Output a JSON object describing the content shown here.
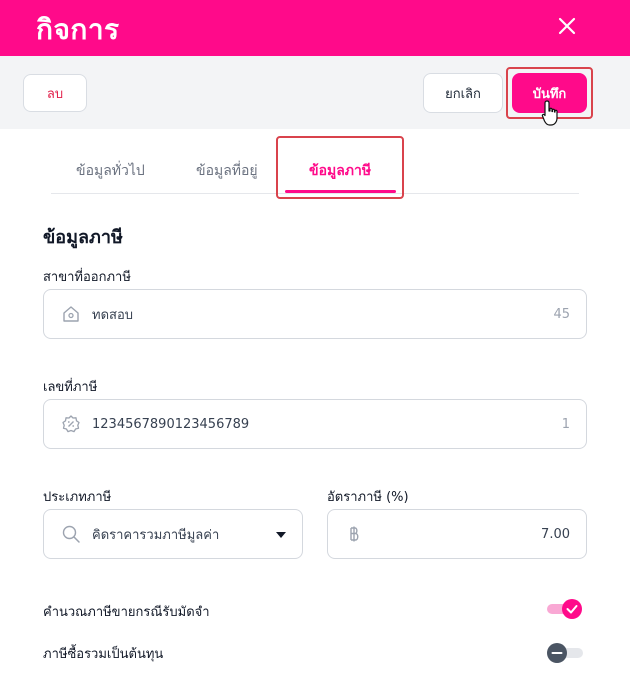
{
  "header": {
    "title": "กิจการ"
  },
  "toolbar": {
    "delete_label": "ลบ",
    "cancel_label": "ยกเลิก",
    "save_label": "บันทึก"
  },
  "tabs": [
    {
      "label": "ข้อมูลทั่วไป"
    },
    {
      "label": "ข้อมูลที่อยู่"
    },
    {
      "label": "ข้อมูลภาษี"
    }
  ],
  "section": {
    "title": "ข้อมูลภาษี"
  },
  "branch": {
    "label": "สาขาที่ออกภาษี",
    "value": "ทดสอบ",
    "count": "45"
  },
  "tax_id": {
    "label": "เลขที่ภาษี",
    "value": "1234567890123456789",
    "count": "1"
  },
  "tax_type": {
    "label": "ประเภทภาษี",
    "value": "คิดราคารวมภาษีมูลค่า"
  },
  "tax_rate": {
    "label": "อัตราภาษี (%)",
    "value": "7.00"
  },
  "toggles": [
    {
      "label": "คำนวณภาษีขายกรณีรับมัดจำ",
      "on": true
    },
    {
      "label": "ภาษีซื้อรวมเป็นต้นทุน",
      "on": false
    }
  ],
  "colors": {
    "accent": "#ff0a8a",
    "highlight_border": "#d9434c",
    "delete_text": "#e11d48"
  }
}
